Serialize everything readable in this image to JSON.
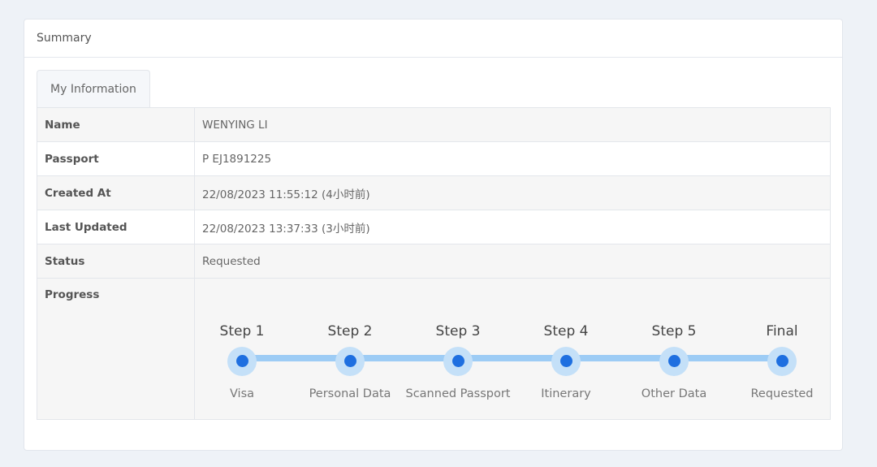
{
  "panel": {
    "heading": "Summary"
  },
  "tabs": [
    {
      "label": "My Information"
    }
  ],
  "info": {
    "rows": [
      {
        "key": "Name",
        "value": "WENYING LI"
      },
      {
        "key": "Passport",
        "value": "P EJ1891225"
      },
      {
        "key": "Created At",
        "value": "22/08/2023 11:55:12 (4小时前)"
      },
      {
        "key": "Last Updated",
        "value": "22/08/2023 13:37:33 (3小时前)"
      },
      {
        "key": "Status",
        "value": "Requested"
      }
    ],
    "progress_label": "Progress"
  },
  "progress": {
    "steps": [
      {
        "title": "Step 1",
        "description": "Visa"
      },
      {
        "title": "Step 2",
        "description": "Personal Data"
      },
      {
        "title": "Step 3",
        "description": "Scanned Passport"
      },
      {
        "title": "Step 4",
        "description": "Itinerary"
      },
      {
        "title": "Step 5",
        "description": "Other Data"
      },
      {
        "title": "Final",
        "description": "Requested"
      }
    ],
    "colors": {
      "track": "#9dccf5",
      "dot_outer": "#c4e0f8",
      "dot_inner": "#1e6fe0"
    }
  }
}
